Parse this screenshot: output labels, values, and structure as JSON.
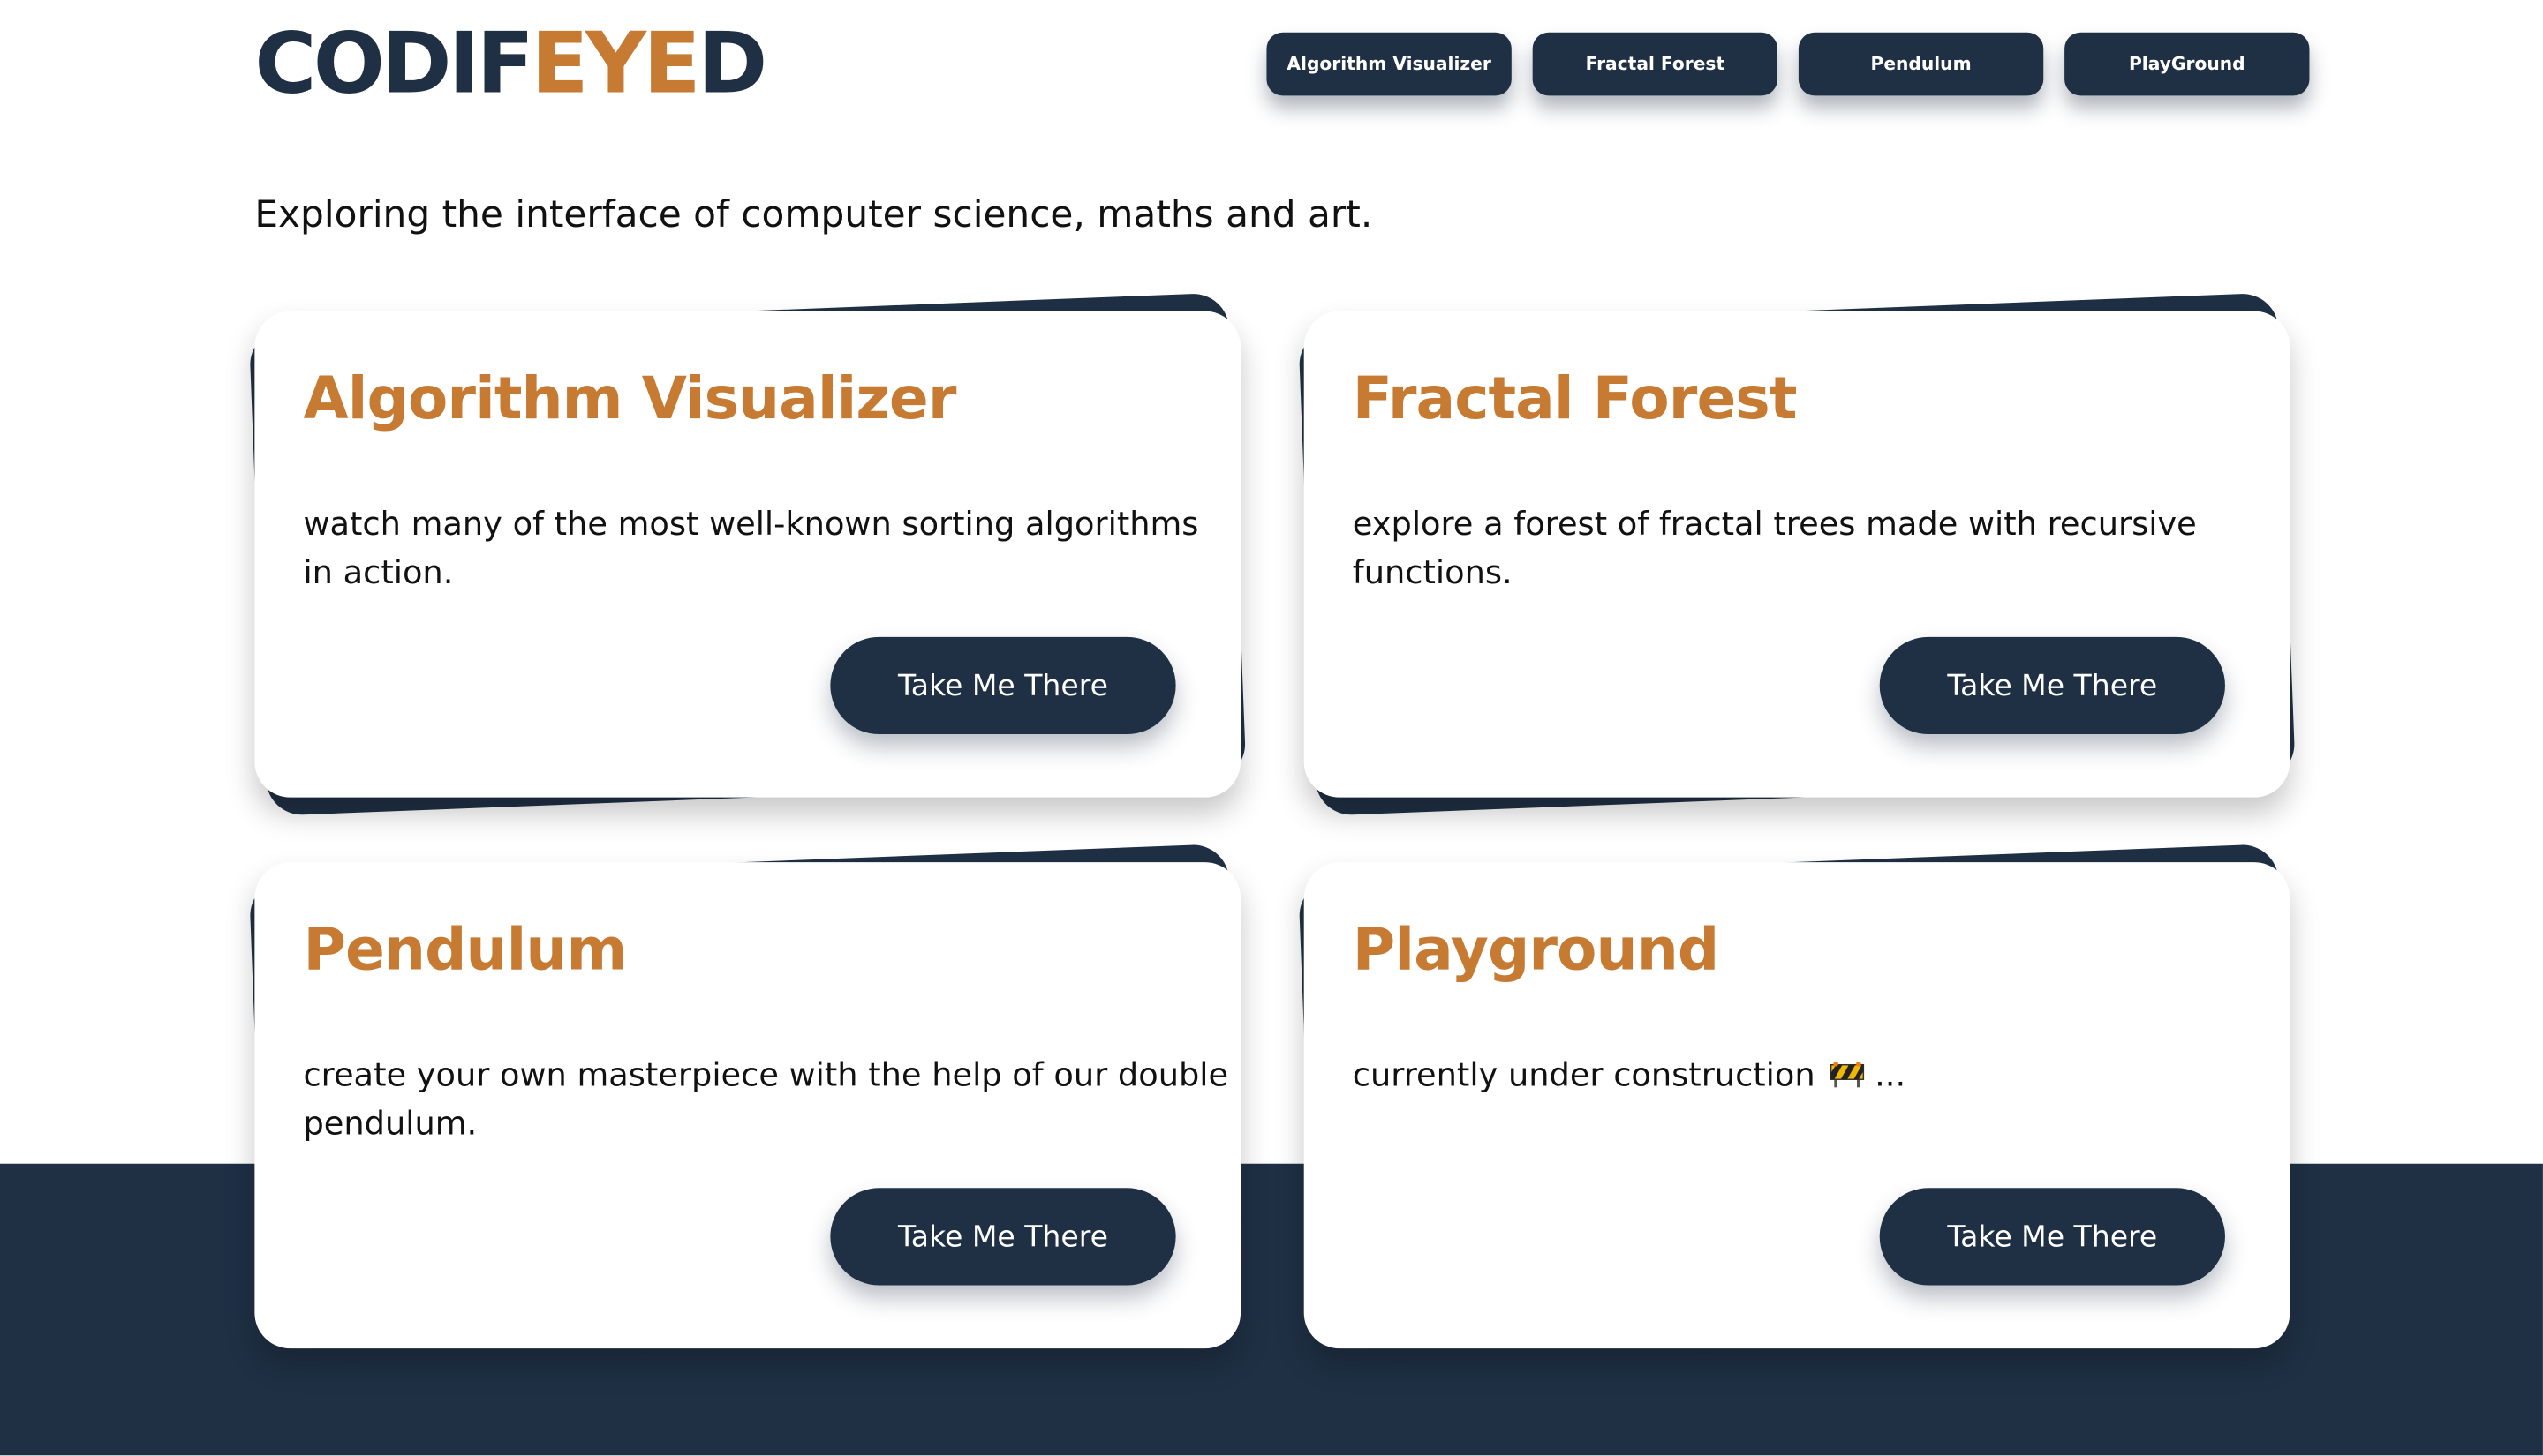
{
  "logo": {
    "part1": "CODIF",
    "part2": "EYE",
    "part3": "D"
  },
  "nav": [
    {
      "label": "Algorithm Visualizer"
    },
    {
      "label": "Fractal Forest"
    },
    {
      "label": "Pendulum"
    },
    {
      "label": "PlayGround"
    }
  ],
  "tagline": "Exploring the interface of computer science, maths and art.",
  "cards": [
    {
      "title": "Algorithm Visualizer",
      "description": "watch many of the most well-known sorting algorithms in action.",
      "button": "Take Me There"
    },
    {
      "title": "Fractal Forest",
      "description": "explore a forest of fractal trees made with recursive functions.",
      "button": "Take Me There"
    },
    {
      "title": "Pendulum",
      "description": "create your own masterpiece with the help of our double pendulum.",
      "button": "Take Me There"
    },
    {
      "title": "Playground",
      "description": "currently under construction",
      "description_suffix": "...",
      "icon": "construction-icon",
      "button": "Take Me There"
    }
  ],
  "colors": {
    "navy": "#1f3044",
    "accent": "#c67a32",
    "background": "#ffffff"
  }
}
